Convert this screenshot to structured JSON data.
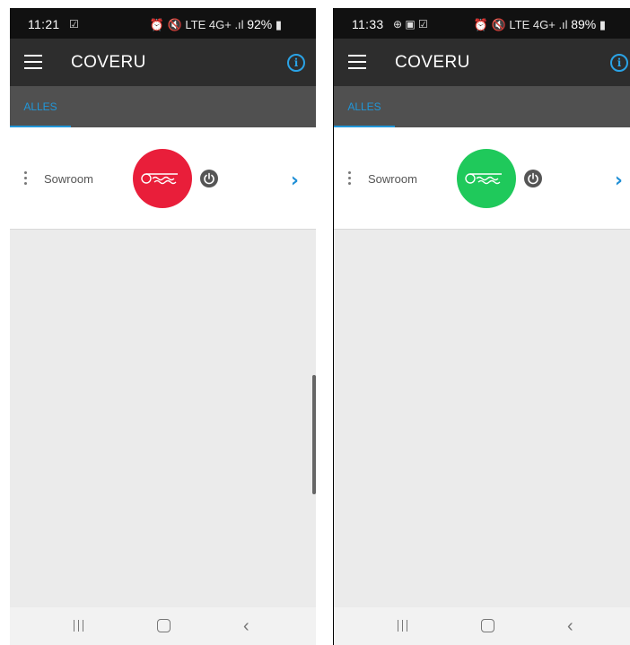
{
  "screens": [
    {
      "status_bar": {
        "time": "11:21",
        "left_icons": "☑",
        "right_icons": "⏰ 🔇 LTE 4G+ .ıl",
        "battery": "92%"
      },
      "app_title": "COVERU",
      "tab": "ALLES",
      "device": {
        "name": "Sowroom",
        "status_color": "#e91e3a"
      },
      "scroll_visible": true
    },
    {
      "status_bar": {
        "time": "11:33",
        "left_icons": "⊕ ▣ ☑",
        "right_icons": "⏰ 🔇 LTE 4G+ .ıl",
        "battery": "89%"
      },
      "app_title": "COVERU",
      "tab": "ALLES",
      "device": {
        "name": "Sowroom",
        "status_color": "#1fc95b"
      },
      "scroll_visible": false
    }
  ],
  "icons": {
    "menu": "hamburger-icon",
    "info": "info-icon",
    "device_menu": "kebab-icon",
    "cover": "pool-cover-icon",
    "power": "power-icon",
    "open": "chevron-right-icon",
    "nav_recent": "recent-apps-icon",
    "nav_home": "home-icon",
    "nav_back": "back-icon"
  },
  "colors": {
    "accent": "#2196d8",
    "toolbar": "#2d2d2d",
    "tabbar": "#505050"
  }
}
